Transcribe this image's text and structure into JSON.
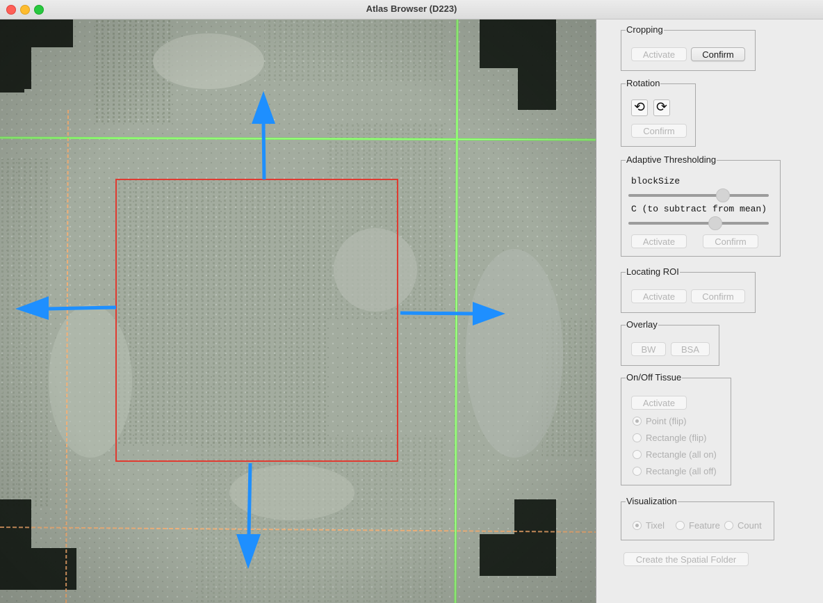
{
  "window": {
    "title": "Atlas Browser (D223)"
  },
  "cropping": {
    "label": "Cropping",
    "activate": "Activate",
    "confirm": "Confirm"
  },
  "rotation": {
    "label": "Rotation",
    "confirm": "Confirm",
    "ccw_icon": "rotate-ccw-icon",
    "cw_icon": "rotate-cw-icon"
  },
  "thresholding": {
    "label": "Adaptive Thresholding",
    "block_size_label": "blockSize",
    "block_size_level": 0.69,
    "c_label": "C (to subtract from mean)",
    "c_level": 0.63,
    "activate": "Activate",
    "confirm": "Confirm"
  },
  "roi": {
    "label": "Locating ROI",
    "activate": "Activate",
    "confirm": "Confirm"
  },
  "overlay": {
    "label": "Overlay",
    "bw": "BW",
    "bsa": "BSA"
  },
  "tissue": {
    "label": "On/Off Tissue",
    "activate": "Activate",
    "options": [
      "Point (flip)",
      "Rectangle (flip)",
      "Rectangle (all on)",
      "Rectangle (all off)"
    ],
    "selected": 0
  },
  "visualization": {
    "label": "Visualization",
    "options": [
      "Tixel",
      "Feature",
      "Count"
    ],
    "selected": 0
  },
  "create_folder": "Create the Spatial Folder",
  "colors": {
    "crop_rect": "#e03a30",
    "arrow": "#1e8fff",
    "laser_green": "#6dff4a",
    "laser_orange": "#ffb070",
    "tissue_bg": "#9ea89c"
  }
}
